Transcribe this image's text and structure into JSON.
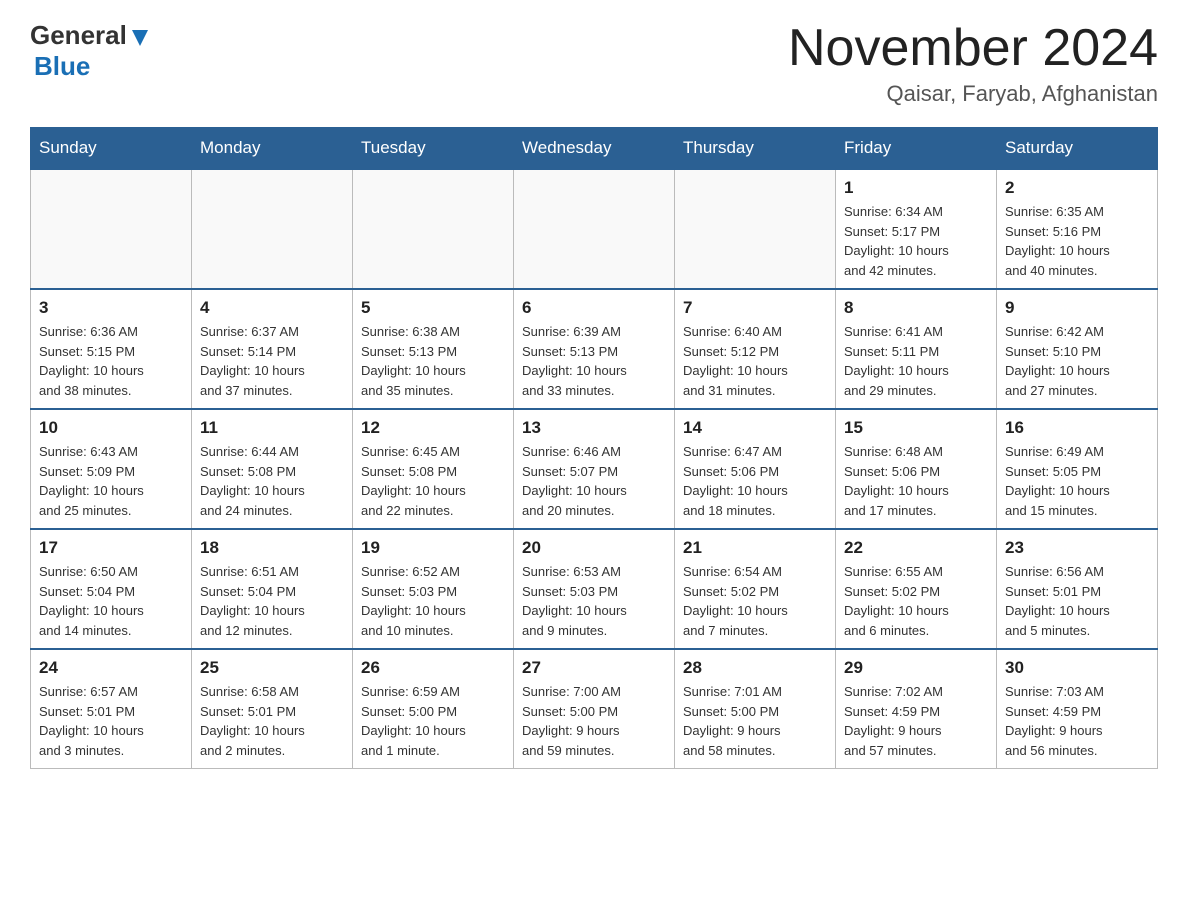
{
  "header": {
    "logo_general": "General",
    "logo_blue": "Blue",
    "month_title": "November 2024",
    "location": "Qaisar, Faryab, Afghanistan"
  },
  "weekdays": [
    "Sunday",
    "Monday",
    "Tuesday",
    "Wednesday",
    "Thursday",
    "Friday",
    "Saturday"
  ],
  "weeks": [
    [
      {
        "day": "",
        "info": ""
      },
      {
        "day": "",
        "info": ""
      },
      {
        "day": "",
        "info": ""
      },
      {
        "day": "",
        "info": ""
      },
      {
        "day": "",
        "info": ""
      },
      {
        "day": "1",
        "info": "Sunrise: 6:34 AM\nSunset: 5:17 PM\nDaylight: 10 hours\nand 42 minutes."
      },
      {
        "day": "2",
        "info": "Sunrise: 6:35 AM\nSunset: 5:16 PM\nDaylight: 10 hours\nand 40 minutes."
      }
    ],
    [
      {
        "day": "3",
        "info": "Sunrise: 6:36 AM\nSunset: 5:15 PM\nDaylight: 10 hours\nand 38 minutes."
      },
      {
        "day": "4",
        "info": "Sunrise: 6:37 AM\nSunset: 5:14 PM\nDaylight: 10 hours\nand 37 minutes."
      },
      {
        "day": "5",
        "info": "Sunrise: 6:38 AM\nSunset: 5:13 PM\nDaylight: 10 hours\nand 35 minutes."
      },
      {
        "day": "6",
        "info": "Sunrise: 6:39 AM\nSunset: 5:13 PM\nDaylight: 10 hours\nand 33 minutes."
      },
      {
        "day": "7",
        "info": "Sunrise: 6:40 AM\nSunset: 5:12 PM\nDaylight: 10 hours\nand 31 minutes."
      },
      {
        "day": "8",
        "info": "Sunrise: 6:41 AM\nSunset: 5:11 PM\nDaylight: 10 hours\nand 29 minutes."
      },
      {
        "day": "9",
        "info": "Sunrise: 6:42 AM\nSunset: 5:10 PM\nDaylight: 10 hours\nand 27 minutes."
      }
    ],
    [
      {
        "day": "10",
        "info": "Sunrise: 6:43 AM\nSunset: 5:09 PM\nDaylight: 10 hours\nand 25 minutes."
      },
      {
        "day": "11",
        "info": "Sunrise: 6:44 AM\nSunset: 5:08 PM\nDaylight: 10 hours\nand 24 minutes."
      },
      {
        "day": "12",
        "info": "Sunrise: 6:45 AM\nSunset: 5:08 PM\nDaylight: 10 hours\nand 22 minutes."
      },
      {
        "day": "13",
        "info": "Sunrise: 6:46 AM\nSunset: 5:07 PM\nDaylight: 10 hours\nand 20 minutes."
      },
      {
        "day": "14",
        "info": "Sunrise: 6:47 AM\nSunset: 5:06 PM\nDaylight: 10 hours\nand 18 minutes."
      },
      {
        "day": "15",
        "info": "Sunrise: 6:48 AM\nSunset: 5:06 PM\nDaylight: 10 hours\nand 17 minutes."
      },
      {
        "day": "16",
        "info": "Sunrise: 6:49 AM\nSunset: 5:05 PM\nDaylight: 10 hours\nand 15 minutes."
      }
    ],
    [
      {
        "day": "17",
        "info": "Sunrise: 6:50 AM\nSunset: 5:04 PM\nDaylight: 10 hours\nand 14 minutes."
      },
      {
        "day": "18",
        "info": "Sunrise: 6:51 AM\nSunset: 5:04 PM\nDaylight: 10 hours\nand 12 minutes."
      },
      {
        "day": "19",
        "info": "Sunrise: 6:52 AM\nSunset: 5:03 PM\nDaylight: 10 hours\nand 10 minutes."
      },
      {
        "day": "20",
        "info": "Sunrise: 6:53 AM\nSunset: 5:03 PM\nDaylight: 10 hours\nand 9 minutes."
      },
      {
        "day": "21",
        "info": "Sunrise: 6:54 AM\nSunset: 5:02 PM\nDaylight: 10 hours\nand 7 minutes."
      },
      {
        "day": "22",
        "info": "Sunrise: 6:55 AM\nSunset: 5:02 PM\nDaylight: 10 hours\nand 6 minutes."
      },
      {
        "day": "23",
        "info": "Sunrise: 6:56 AM\nSunset: 5:01 PM\nDaylight: 10 hours\nand 5 minutes."
      }
    ],
    [
      {
        "day": "24",
        "info": "Sunrise: 6:57 AM\nSunset: 5:01 PM\nDaylight: 10 hours\nand 3 minutes."
      },
      {
        "day": "25",
        "info": "Sunrise: 6:58 AM\nSunset: 5:01 PM\nDaylight: 10 hours\nand 2 minutes."
      },
      {
        "day": "26",
        "info": "Sunrise: 6:59 AM\nSunset: 5:00 PM\nDaylight: 10 hours\nand 1 minute."
      },
      {
        "day": "27",
        "info": "Sunrise: 7:00 AM\nSunset: 5:00 PM\nDaylight: 9 hours\nand 59 minutes."
      },
      {
        "day": "28",
        "info": "Sunrise: 7:01 AM\nSunset: 5:00 PM\nDaylight: 9 hours\nand 58 minutes."
      },
      {
        "day": "29",
        "info": "Sunrise: 7:02 AM\nSunset: 4:59 PM\nDaylight: 9 hours\nand 57 minutes."
      },
      {
        "day": "30",
        "info": "Sunrise: 7:03 AM\nSunset: 4:59 PM\nDaylight: 9 hours\nand 56 minutes."
      }
    ]
  ]
}
